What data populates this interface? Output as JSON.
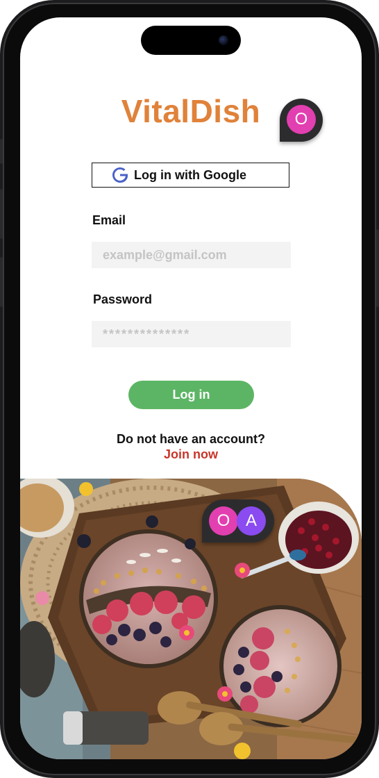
{
  "app": {
    "brand": "VitalDish",
    "brand_color": "#e0823a"
  },
  "presence": {
    "top_avatar": {
      "initial": "O",
      "color": "#e23fb1"
    },
    "photo_avatars": [
      {
        "initial": "O",
        "color": "#e23fb1"
      },
      {
        "initial": "A",
        "color": "#8a4bf0"
      }
    ]
  },
  "login": {
    "google_label": "Log in with Google",
    "google_icon": "google-g-icon",
    "email_label": "Email",
    "email_placeholder": "example@gmail.com",
    "password_label": "Password",
    "password_placeholder": "**************",
    "submit_label": "Log in",
    "submit_color": "#5cb564",
    "no_account_text": "Do not have an account?",
    "join_label": "Join now",
    "join_color": "#c8352a"
  }
}
